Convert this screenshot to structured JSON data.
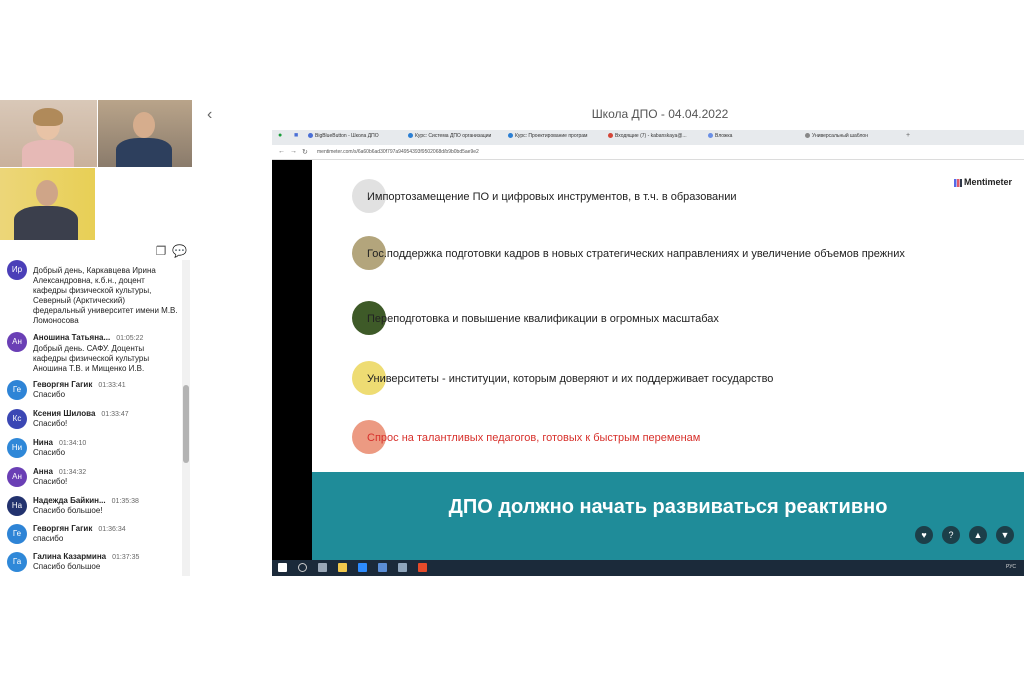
{
  "presentation": {
    "title": "Школа ДПО - 04.04.2022"
  },
  "browser": {
    "tabs": [
      {
        "label": "BigBlueButton - Школа ДПО",
        "color": "#4a6fd6"
      },
      {
        "label": "Курс: Система ДПО организации",
        "color": "#2b7fd4"
      },
      {
        "label": "Курс: Проектирование програм",
        "color": "#2b7fd4"
      },
      {
        "label": "Входящие (7) - kabanskaya@...",
        "color": "#d44638"
      },
      {
        "label": "Вложка",
        "color": "#6a8fe6"
      },
      {
        "label": "Универсальный шаблон",
        "color": "#888888"
      }
    ],
    "address": "mentimeter.com/s/6a60b6ad30f797a94954393f9502068d/b9b0bd5ae9e2"
  },
  "slide": {
    "brand": "Mentimeter",
    "options": [
      {
        "text": "Импортозамещение ПО и цифровых инструментов, в т.ч. в образовании",
        "color": "#e1e1e1"
      },
      {
        "text": "Гос.поддержка подготовки кадров в новых стратегических направлениях и увеличение объемов прежних",
        "color": "#b3a57c"
      },
      {
        "text": "Переподготовка и повышение квалификации в огромных масштабах",
        "color": "#3e5a28"
      },
      {
        "text": "Университеты - институции, которым доверяют и их поддерживает государство",
        "color": "#eedc73"
      },
      {
        "text": "Спрос на талантливых педагогов, готовых к быстрым переменам",
        "color": "#ec9a82",
        "text_color": "#d7302b"
      }
    ],
    "banner": "ДПО должно начать развиваться реактивно",
    "reactions": [
      "heart-icon",
      "question-icon",
      "thumbs-up-icon",
      "thumbs-down-icon"
    ]
  },
  "chat": {
    "messages": [
      {
        "initials": "Ир",
        "color": "#4b3fb8",
        "name": "",
        "time": "",
        "text": "Добрый день, Каркавцева Ирина Александровна, к.б.н., доцент кафедры физической культуры, Северный (Арктический) федеральный университет имени М.В. Ломоносова"
      },
      {
        "initials": "Ан",
        "color": "#6a3fb5",
        "name": "Аношина Татьяна...",
        "time": "01:05:22",
        "text": "Добрый день. САФУ. Доценты кафедры физической культуры Аношина Т.В. и Мищенко И.В."
      },
      {
        "initials": "Ге",
        "color": "#2e84d6",
        "name": "Геворгян Гагик",
        "time": "01:33:41",
        "text": "Спасибо"
      },
      {
        "initials": "Кс",
        "color": "#3b47b4",
        "name": "Ксения Шилова",
        "time": "01:33:47",
        "text": "Спасибо!"
      },
      {
        "initials": "Ни",
        "color": "#2f88d8",
        "name": "Нина",
        "time": "01:34:10",
        "text": "Спасибо"
      },
      {
        "initials": "Ан",
        "color": "#6a3fb5",
        "name": "Анна",
        "time": "01:34:32",
        "text": "Спасибо!"
      },
      {
        "initials": "На",
        "color": "#22326e",
        "name": "Надежда Байкин...",
        "time": "01:35:38",
        "text": "Спасибо большое!"
      },
      {
        "initials": "Ге",
        "color": "#2e84d6",
        "name": "Геворгян Гагик",
        "time": "01:36:34",
        "text": "спасибо"
      },
      {
        "initials": "Га",
        "color": "#2f88d8",
        "name": "Галина Казармина",
        "time": "01:37:35",
        "text": "Спасибо большое"
      }
    ]
  },
  "taskbar": {
    "tray": "РУС"
  }
}
